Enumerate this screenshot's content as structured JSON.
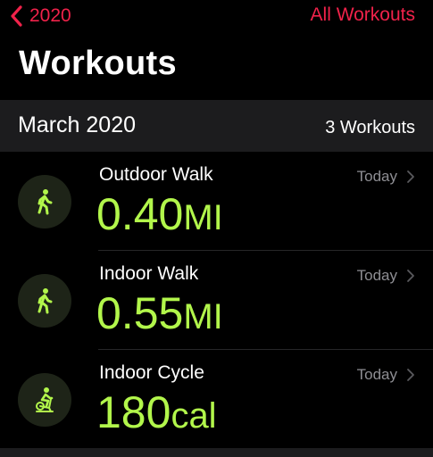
{
  "nav": {
    "back_label": "2020",
    "all_workouts_label": "All Workouts"
  },
  "page": {
    "title": "Workouts"
  },
  "section": {
    "title": "March 2020",
    "count": "3 Workouts"
  },
  "workouts": [
    {
      "name": "Outdoor Walk",
      "date": "Today",
      "value": "0.40",
      "unit": "MI",
      "icon": "walking-figure-icon"
    },
    {
      "name": "Indoor Walk",
      "date": "Today",
      "value": "0.55",
      "unit": "MI",
      "icon": "walking-figure-icon"
    },
    {
      "name": "Indoor Cycle",
      "date": "Today",
      "value": "180",
      "unit": "cal",
      "icon": "stationary-bike-icon"
    }
  ],
  "colors": {
    "accent": "#f0224a",
    "metric": "#b2f64b",
    "secondary_text": "#8e8e93",
    "section_background": "#1c1c1e"
  }
}
